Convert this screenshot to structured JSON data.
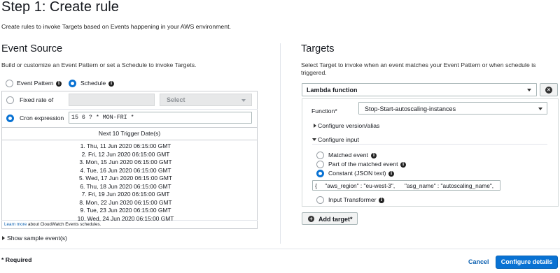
{
  "page": {
    "title": "Step 1: Create rule",
    "subtitle": "Create rules to invoke Targets based on Events happening in your AWS environment."
  },
  "event_source": {
    "heading": "Event Source",
    "description": "Build or customize an Event Pattern or set a Schedule to invoke Targets.",
    "option_event_pattern": "Event Pattern",
    "option_schedule": "Schedule",
    "selected_mode": "Schedule",
    "fixed_rate_label": "Fixed rate of",
    "fixed_rate_value": "",
    "unit_select_placeholder": "Select",
    "cron_label": "Cron expression",
    "cron_value": "15 6 ? * MON-FRI *",
    "trigger_header": "Next 10 Trigger Date(s)",
    "triggers": [
      "1. Thu, 11 Jun 2020 06:15:00 GMT",
      "2. Fri, 12 Jun 2020 06:15:00 GMT",
      "3. Mon, 15 Jun 2020 06:15:00 GMT",
      "4. Tue, 16 Jun 2020 06:15:00 GMT",
      "5. Wed, 17 Jun 2020 06:15:00 GMT",
      "6. Thu, 18 Jun 2020 06:15:00 GMT",
      "7. Fri, 19 Jun 2020 06:15:00 GMT",
      "8. Mon, 22 Jun 2020 06:15:00 GMT",
      "9. Tue, 23 Jun 2020 06:15:00 GMT",
      "10. Wed, 24 Jun 2020 06:15:00 GMT"
    ],
    "learn_more_link": "Learn more",
    "learn_more_suffix": " about CloudWatch Events schedules.",
    "show_sample": "Show sample event(s)"
  },
  "targets": {
    "heading": "Targets",
    "description": "Select Target to invoke when an event matches your Event Pattern or when schedule is triggered.",
    "target_type": "Lambda function",
    "function_label": "Function*",
    "function_value": "Stop-Start-autoscaling-instances",
    "configure_version": "Configure version/alias",
    "configure_input": "Configure input",
    "input_matched": "Matched event",
    "input_part": "Part of the matched event",
    "input_constant": "Constant (JSON text)",
    "input_transformer": "Input Transformer",
    "selected_input": "Constant (JSON text)",
    "json_value": "{     \"aws_region\" : \"eu-west-3\",      \"asg_name\" : \"autoscaling_name\",",
    "add_target": "Add target*"
  },
  "footer": {
    "required_note": "* Required",
    "cancel": "Cancel",
    "configure_details": "Configure details"
  },
  "colors": {
    "accent": "#0972d3",
    "link": "#0a5fb0",
    "border": "#c9ccd1"
  }
}
